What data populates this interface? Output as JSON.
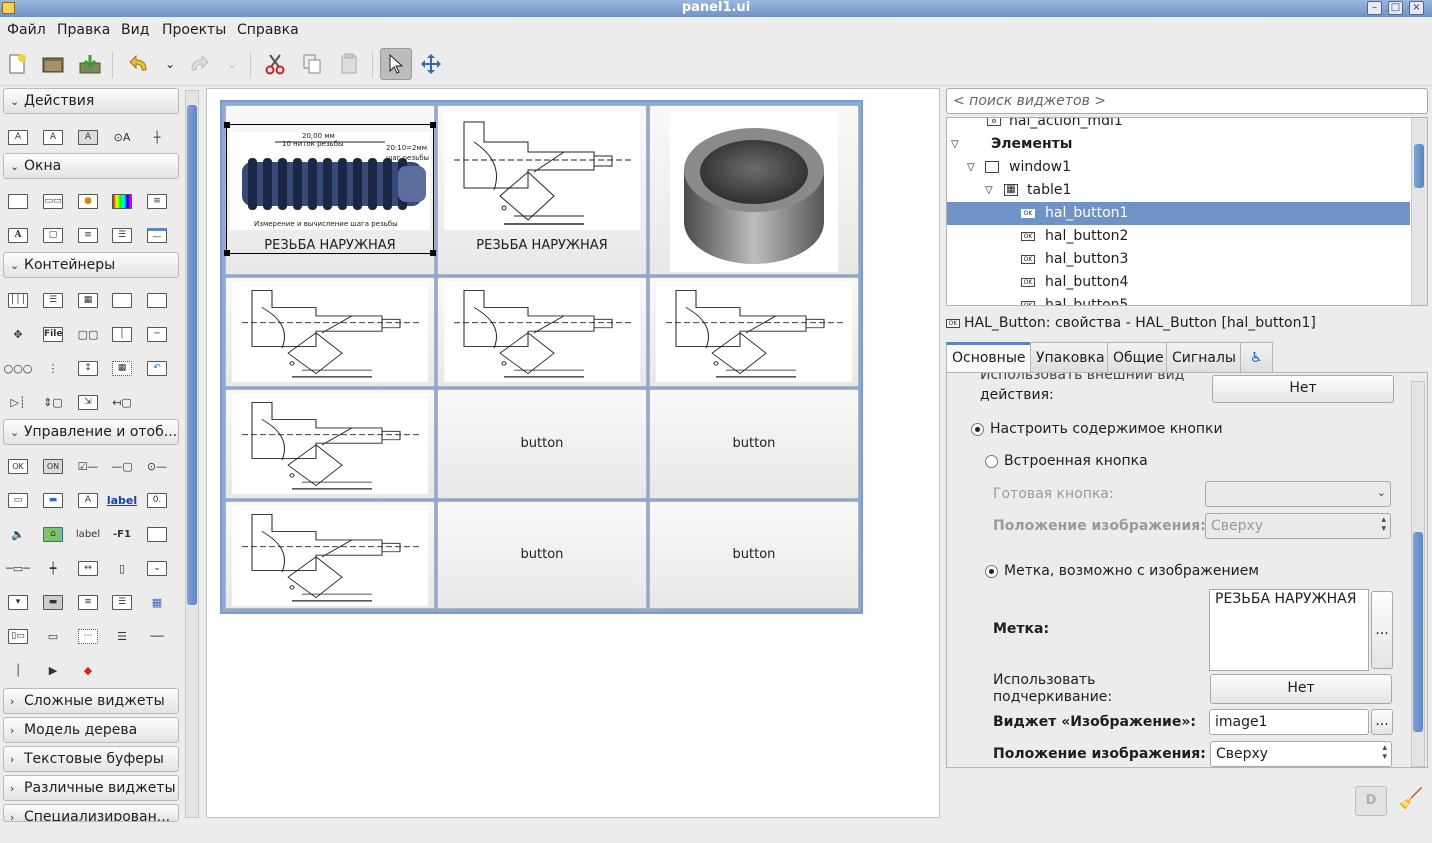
{
  "window": {
    "title": "panel1.ui"
  },
  "menu": [
    "Файл",
    "Правка",
    "Вид",
    "Проекты",
    "Справка"
  ],
  "toolbar": {
    "icons": [
      "new-file-icon",
      "open-icon",
      "save-icon",
      "undo-icon",
      "undo-dropdown-icon",
      "redo-icon",
      "redo-dropdown-icon",
      "cut-icon",
      "copy-icon",
      "paste-icon",
      "pointer-icon",
      "move-icon"
    ]
  },
  "palette": {
    "groups": {
      "actions": "Действия",
      "windows": "Окна",
      "containers": "Контейнеры",
      "control": "Управление и отоб...",
      "complex": "Сложные виджеты",
      "tree_model": "Модель дерева",
      "text_buffers": "Текстовые буферы",
      "misc": "Различные виджеты",
      "special": "Специализирован..."
    },
    "icon_texts": {
      "file": "File",
      "ok": "OK",
      "on": "ON",
      "label1": "label",
      "label2": "label",
      "f1": "-F1",
      "a": "A"
    }
  },
  "canvas": {
    "cells": [
      {
        "label": "РЕЗЬБА НАРУЖНАЯ",
        "image": "thread-photo"
      },
      {
        "label": "РЕЗЬБА НАРУЖНАЯ",
        "image": "tech-drawing"
      },
      {
        "label": "",
        "image": "steel-coupling-photo"
      },
      {
        "label": "",
        "image": "tech-drawing"
      },
      {
        "label": "",
        "image": "tech-drawing"
      },
      {
        "label": "",
        "image": "tech-drawing"
      },
      {
        "label": "",
        "image": "tech-drawing"
      },
      {
        "label": "button",
        "image": ""
      },
      {
        "label": "button",
        "image": ""
      },
      {
        "label": "",
        "image": "tech-drawing"
      },
      {
        "label": "button",
        "image": ""
      },
      {
        "label": "button",
        "image": ""
      }
    ],
    "thread_photo_text": {
      "top": "20,00 мм",
      "sub": "10 ниток резьбы",
      "right1": "20:10=2мм",
      "right2": "шаг резьбы",
      "bottom": "Измерение и вычисление шага резьбы"
    }
  },
  "inspector": {
    "search_placeholder": "< поиск виджетов >",
    "tree": [
      {
        "label": "hal_action_mdi1",
        "level": 2,
        "icon": "action-icon"
      },
      {
        "label": "Элементы",
        "level": 0,
        "bold": true
      },
      {
        "label": "window1",
        "level": 1
      },
      {
        "label": "table1",
        "level": 2
      },
      {
        "label": "hal_button1",
        "level": 3,
        "selected": true
      },
      {
        "label": "hal_button2",
        "level": 3
      },
      {
        "label": "hal_button3",
        "level": 3
      },
      {
        "label": "hal_button4",
        "level": 3
      },
      {
        "label": "hal_button5",
        "level": 3
      }
    ],
    "prop_title": "HAL_Button: свойства - HAL_Button [hal_button1]",
    "tabs": [
      "Основные",
      "Упаковка",
      "Общие",
      "Сигналы"
    ],
    "active_tab": "Основные",
    "props": {
      "partial_label_top": "Использовать внешний вид",
      "partial_label": "действия:",
      "partial_value": "Нет",
      "configure_content": "Настроить содержимое кнопки",
      "builtin_button": "Встроенная кнопка",
      "ready_button": "Готовая кнопка:",
      "image_position_disabled": "Положение изображения:",
      "image_position_disabled_value": "Сверху",
      "label_with_image": "Метка, возможно с изображением",
      "label_label": "Метка:",
      "label_value": "РЕЗЬБА НАРУЖНАЯ",
      "underline_label_1": "Использовать",
      "underline_label_2": "подчеркивание:",
      "underline_value": "Нет",
      "image_widget_label": "Виджет «Изображение»:",
      "image_widget_value": "image1",
      "image_position_label": "Положение изображения:",
      "image_position_value": "Сверху",
      "ellipsis": "..."
    }
  },
  "colors": {
    "selection": "#6f93c6",
    "accent": "#5f85c1"
  }
}
